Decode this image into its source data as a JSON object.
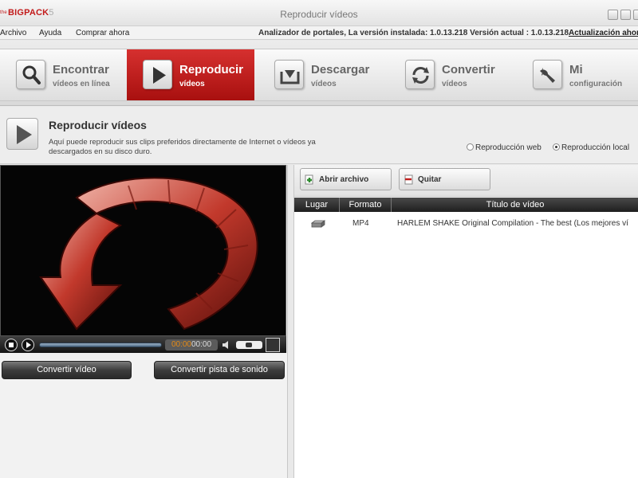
{
  "app": {
    "logo": {
      "prefix": "the",
      "name": "BIGPACK",
      "version": "5"
    },
    "window_title": "Reproducir vídeos"
  },
  "menu": {
    "items": [
      "Archivo",
      "Ayuda",
      "Comprar ahora"
    ],
    "status": "Analizador de portales, La versión instalada: 1.0.13.218  Versión actual : 1.0.13.218",
    "update_link": "Actualización ahora"
  },
  "nav": {
    "items": [
      {
        "title": "Encontrar",
        "subtitle": "vídeos en línea",
        "icon": "search-icon",
        "active": false
      },
      {
        "title": "Reproducir",
        "subtitle": "vídeos",
        "icon": "play-icon",
        "active": true
      },
      {
        "title": "Descargar",
        "subtitle": "vídeos",
        "icon": "download-icon",
        "active": false
      },
      {
        "title": "Convertir",
        "subtitle": "vídeos",
        "icon": "convert-icon",
        "active": false
      },
      {
        "title": "Mi",
        "subtitle": "configuración",
        "icon": "wrench-icon",
        "active": false
      }
    ],
    "active_color": "#c0201f"
  },
  "section": {
    "title": "Reproducir vídeos",
    "description": "Aquí puede reproducir sus clips preferidos directamente de Internet o vídeos ya descargados en su disco duro.",
    "modes": [
      {
        "label": "Reproducción web",
        "selected": false
      },
      {
        "label": "Reproducción local",
        "selected": true
      }
    ]
  },
  "player": {
    "time_current": "00:00",
    "time_total": "00:00",
    "buttons": {
      "convert_video": "Convertir vídeo",
      "convert_audio": "Convertir pista de sonido"
    }
  },
  "file_panel": {
    "open_button": "Abrir archivo",
    "remove_button": "Quitar",
    "columns": [
      "Lugar",
      "Formato",
      "Título de vídeo"
    ],
    "rows": [
      {
        "location_icon": "hard-drive-icon",
        "format": "MP4",
        "title": "HARLEM SHAKE Original Compilation - The best (Los mejores ví"
      }
    ]
  }
}
